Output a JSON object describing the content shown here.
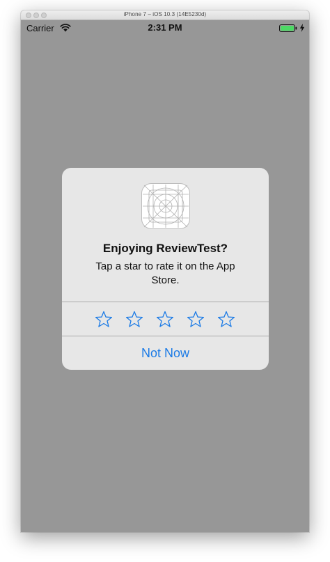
{
  "window": {
    "title": "iPhone 7 – iOS 10.3 (14E5230d)"
  },
  "status_bar": {
    "carrier": "Carrier",
    "time": "2:31 PM",
    "battery_color": "#4cd964"
  },
  "icons": {
    "wifi": "wifi-icon",
    "battery": "battery-icon",
    "charging": "charging-bolt-icon",
    "app": "app-icon-template",
    "star": "star-outline-icon"
  },
  "alert": {
    "title": "Enjoying ReviewTest?",
    "message": "Tap a star to rate it on the App Store.",
    "rating": {
      "max": 5,
      "selected": 0
    },
    "not_now_label": "Not Now",
    "accent_color": "#1a7ae6"
  }
}
